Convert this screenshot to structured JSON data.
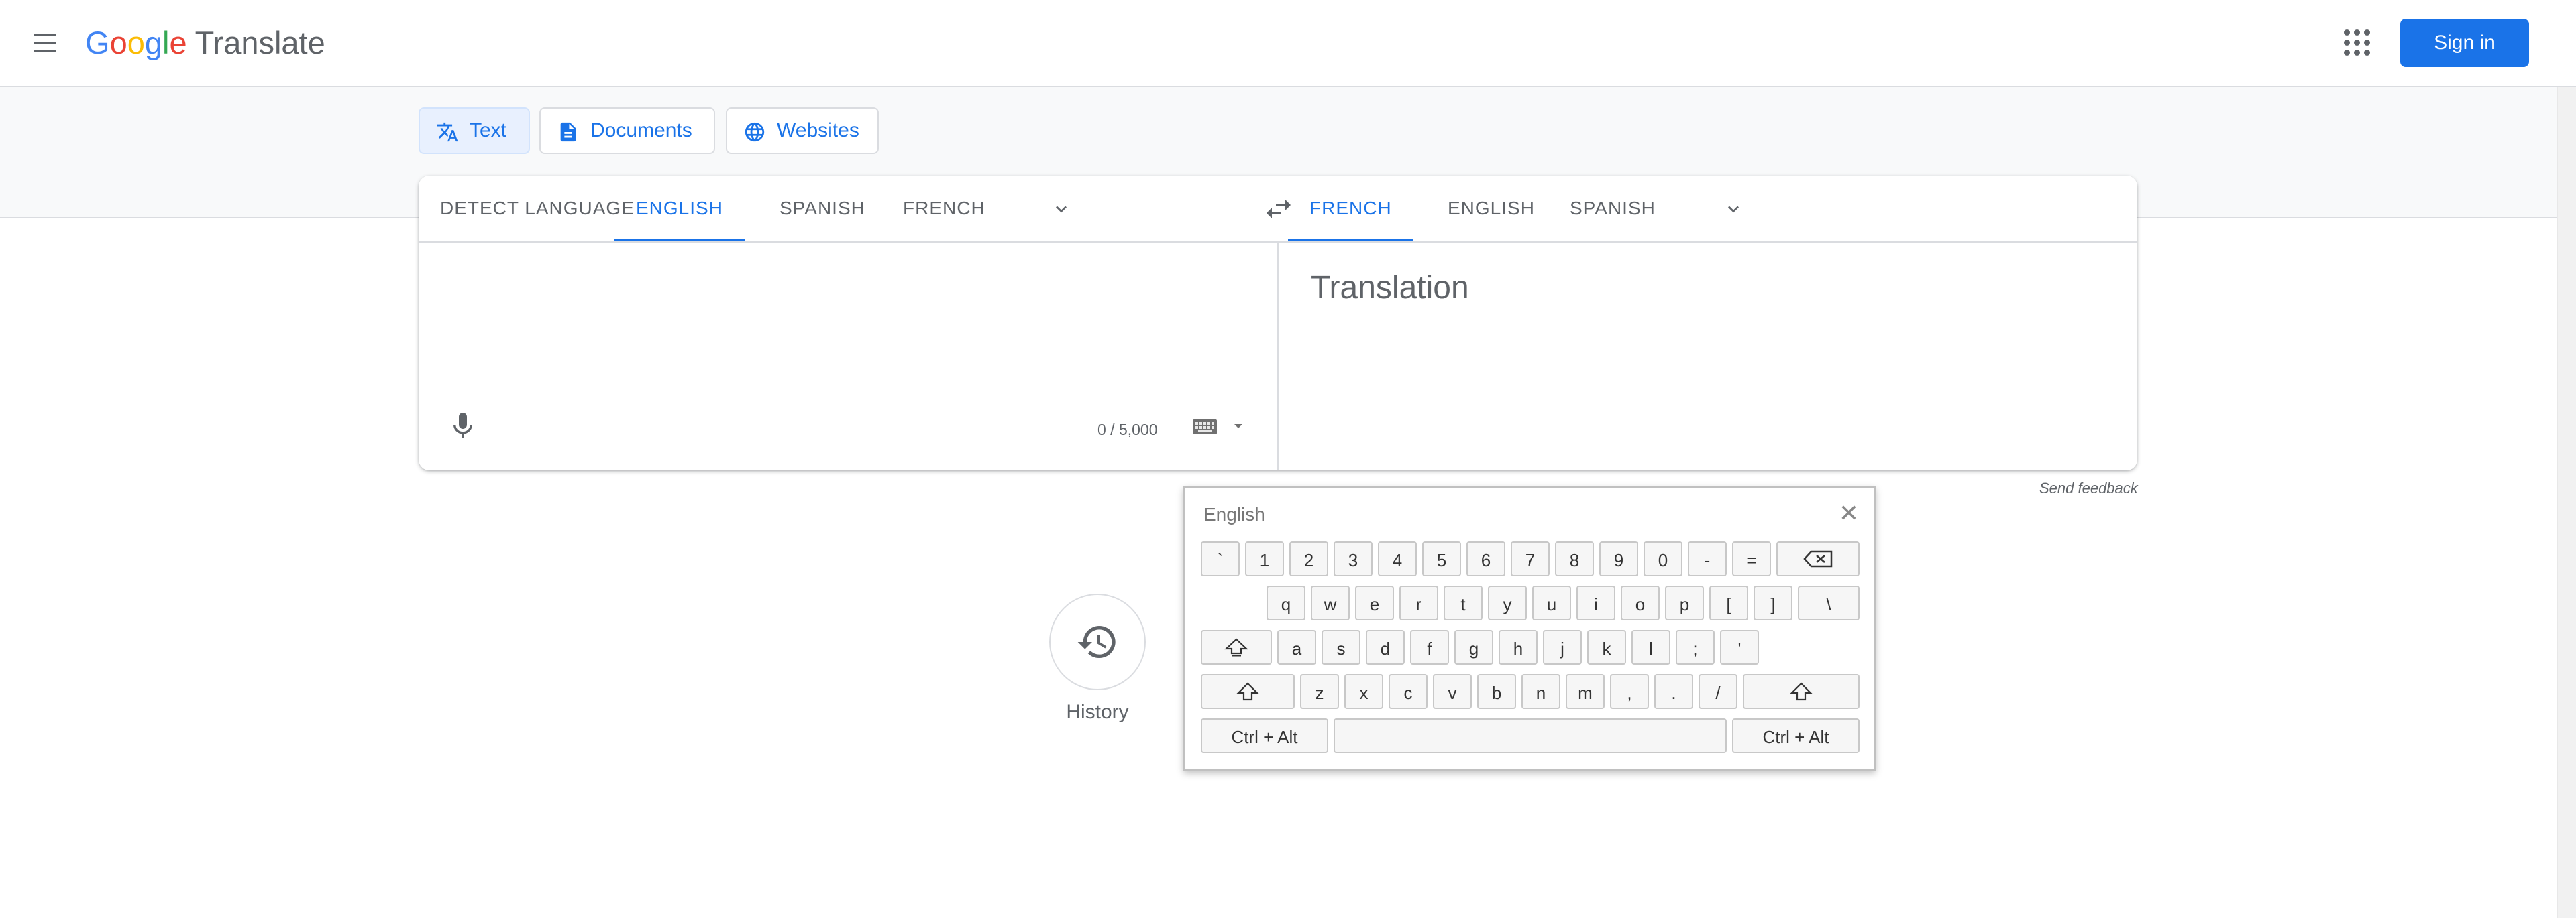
{
  "header": {
    "logo_letters": [
      "G",
      "o",
      "o",
      "g",
      "l",
      "e"
    ],
    "product_name": "Translate",
    "sign_in_label": "Sign in"
  },
  "modes": [
    {
      "label": "Text",
      "icon": "translate-icon",
      "active": true
    },
    {
      "label": "Documents",
      "icon": "document-icon",
      "active": false
    },
    {
      "label": "Websites",
      "icon": "globe-icon",
      "active": false
    }
  ],
  "source": {
    "languages": [
      {
        "label": "DETECT LANGUAGE",
        "active": false
      },
      {
        "label": "ENGLISH",
        "active": true
      },
      {
        "label": "SPANISH",
        "active": false
      },
      {
        "label": "FRENCH",
        "active": false
      }
    ],
    "text": "",
    "char_count": "0 / 5,000"
  },
  "target": {
    "languages": [
      {
        "label": "FRENCH",
        "active": true
      },
      {
        "label": "ENGLISH",
        "active": false
      },
      {
        "label": "SPANISH",
        "active": false
      }
    ],
    "placeholder": "Translation"
  },
  "send_feedback": "Send feedback",
  "history_label": "History",
  "keyboard": {
    "title": "English",
    "close": "✕",
    "rows": [
      [
        "`",
        "1",
        "2",
        "3",
        "4",
        "5",
        "6",
        "7",
        "8",
        "9",
        "0",
        "-",
        "="
      ],
      [
        "q",
        "w",
        "e",
        "r",
        "t",
        "y",
        "u",
        "i",
        "o",
        "p",
        "[",
        "]",
        "\\"
      ],
      [
        "a",
        "s",
        "d",
        "f",
        "g",
        "h",
        "j",
        "k",
        "l",
        ";",
        "'"
      ],
      [
        "z",
        "x",
        "c",
        "v",
        "b",
        "n",
        "m",
        ",",
        ".",
        "/"
      ]
    ],
    "ctrl_alt_left": "Ctrl + Alt",
    "ctrl_alt_right": "Ctrl + Alt"
  },
  "colors": {
    "accent": "#1a73e8",
    "text_secondary": "#5f6368"
  }
}
